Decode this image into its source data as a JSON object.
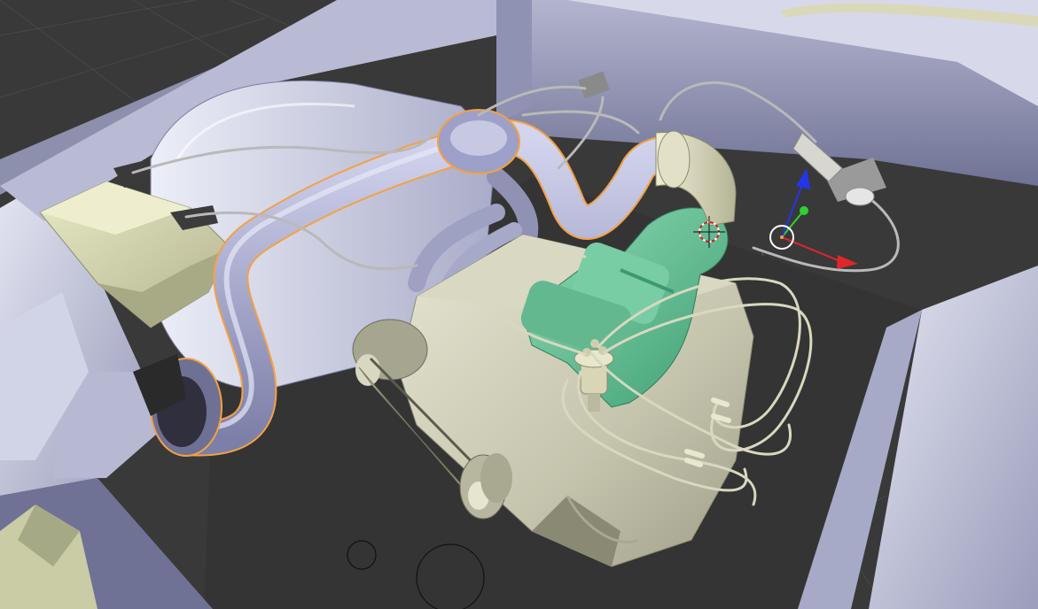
{
  "viewport": {
    "mode": "3d-viewport",
    "shading": "solid",
    "background_color": "#393939",
    "grid_color": "#4a4a4a"
  },
  "colors": {
    "body_panel": "#c5c7dd",
    "body_panel_dark": "#8d90ad",
    "engine_block": "#c9c8b4",
    "intake_green": "#6cc39b",
    "exhaust_pipe": "#9da0c8",
    "selection_outline": "#f5a142",
    "wire": "#d7d6bf",
    "air_box": "#d8d9b0",
    "axis_x": "#e0262a",
    "axis_y": "#2fd12f",
    "axis_z": "#2435e8"
  },
  "gizmo": {
    "axes": [
      "x",
      "y",
      "z"
    ],
    "icon": "transform-manipulator-icon"
  },
  "objects": [
    {
      "name": "exhaust-pipe",
      "selected": true
    },
    {
      "name": "engine-block",
      "selected": false
    },
    {
      "name": "intake-manifold",
      "selected": false
    },
    {
      "name": "air-filter-box",
      "selected": false
    },
    {
      "name": "ignition-distributor",
      "selected": false
    },
    {
      "name": "spark-plug-wires",
      "selected": false
    },
    {
      "name": "drive-belt",
      "selected": false
    },
    {
      "name": "engine-bay-panels",
      "selected": false
    }
  ]
}
